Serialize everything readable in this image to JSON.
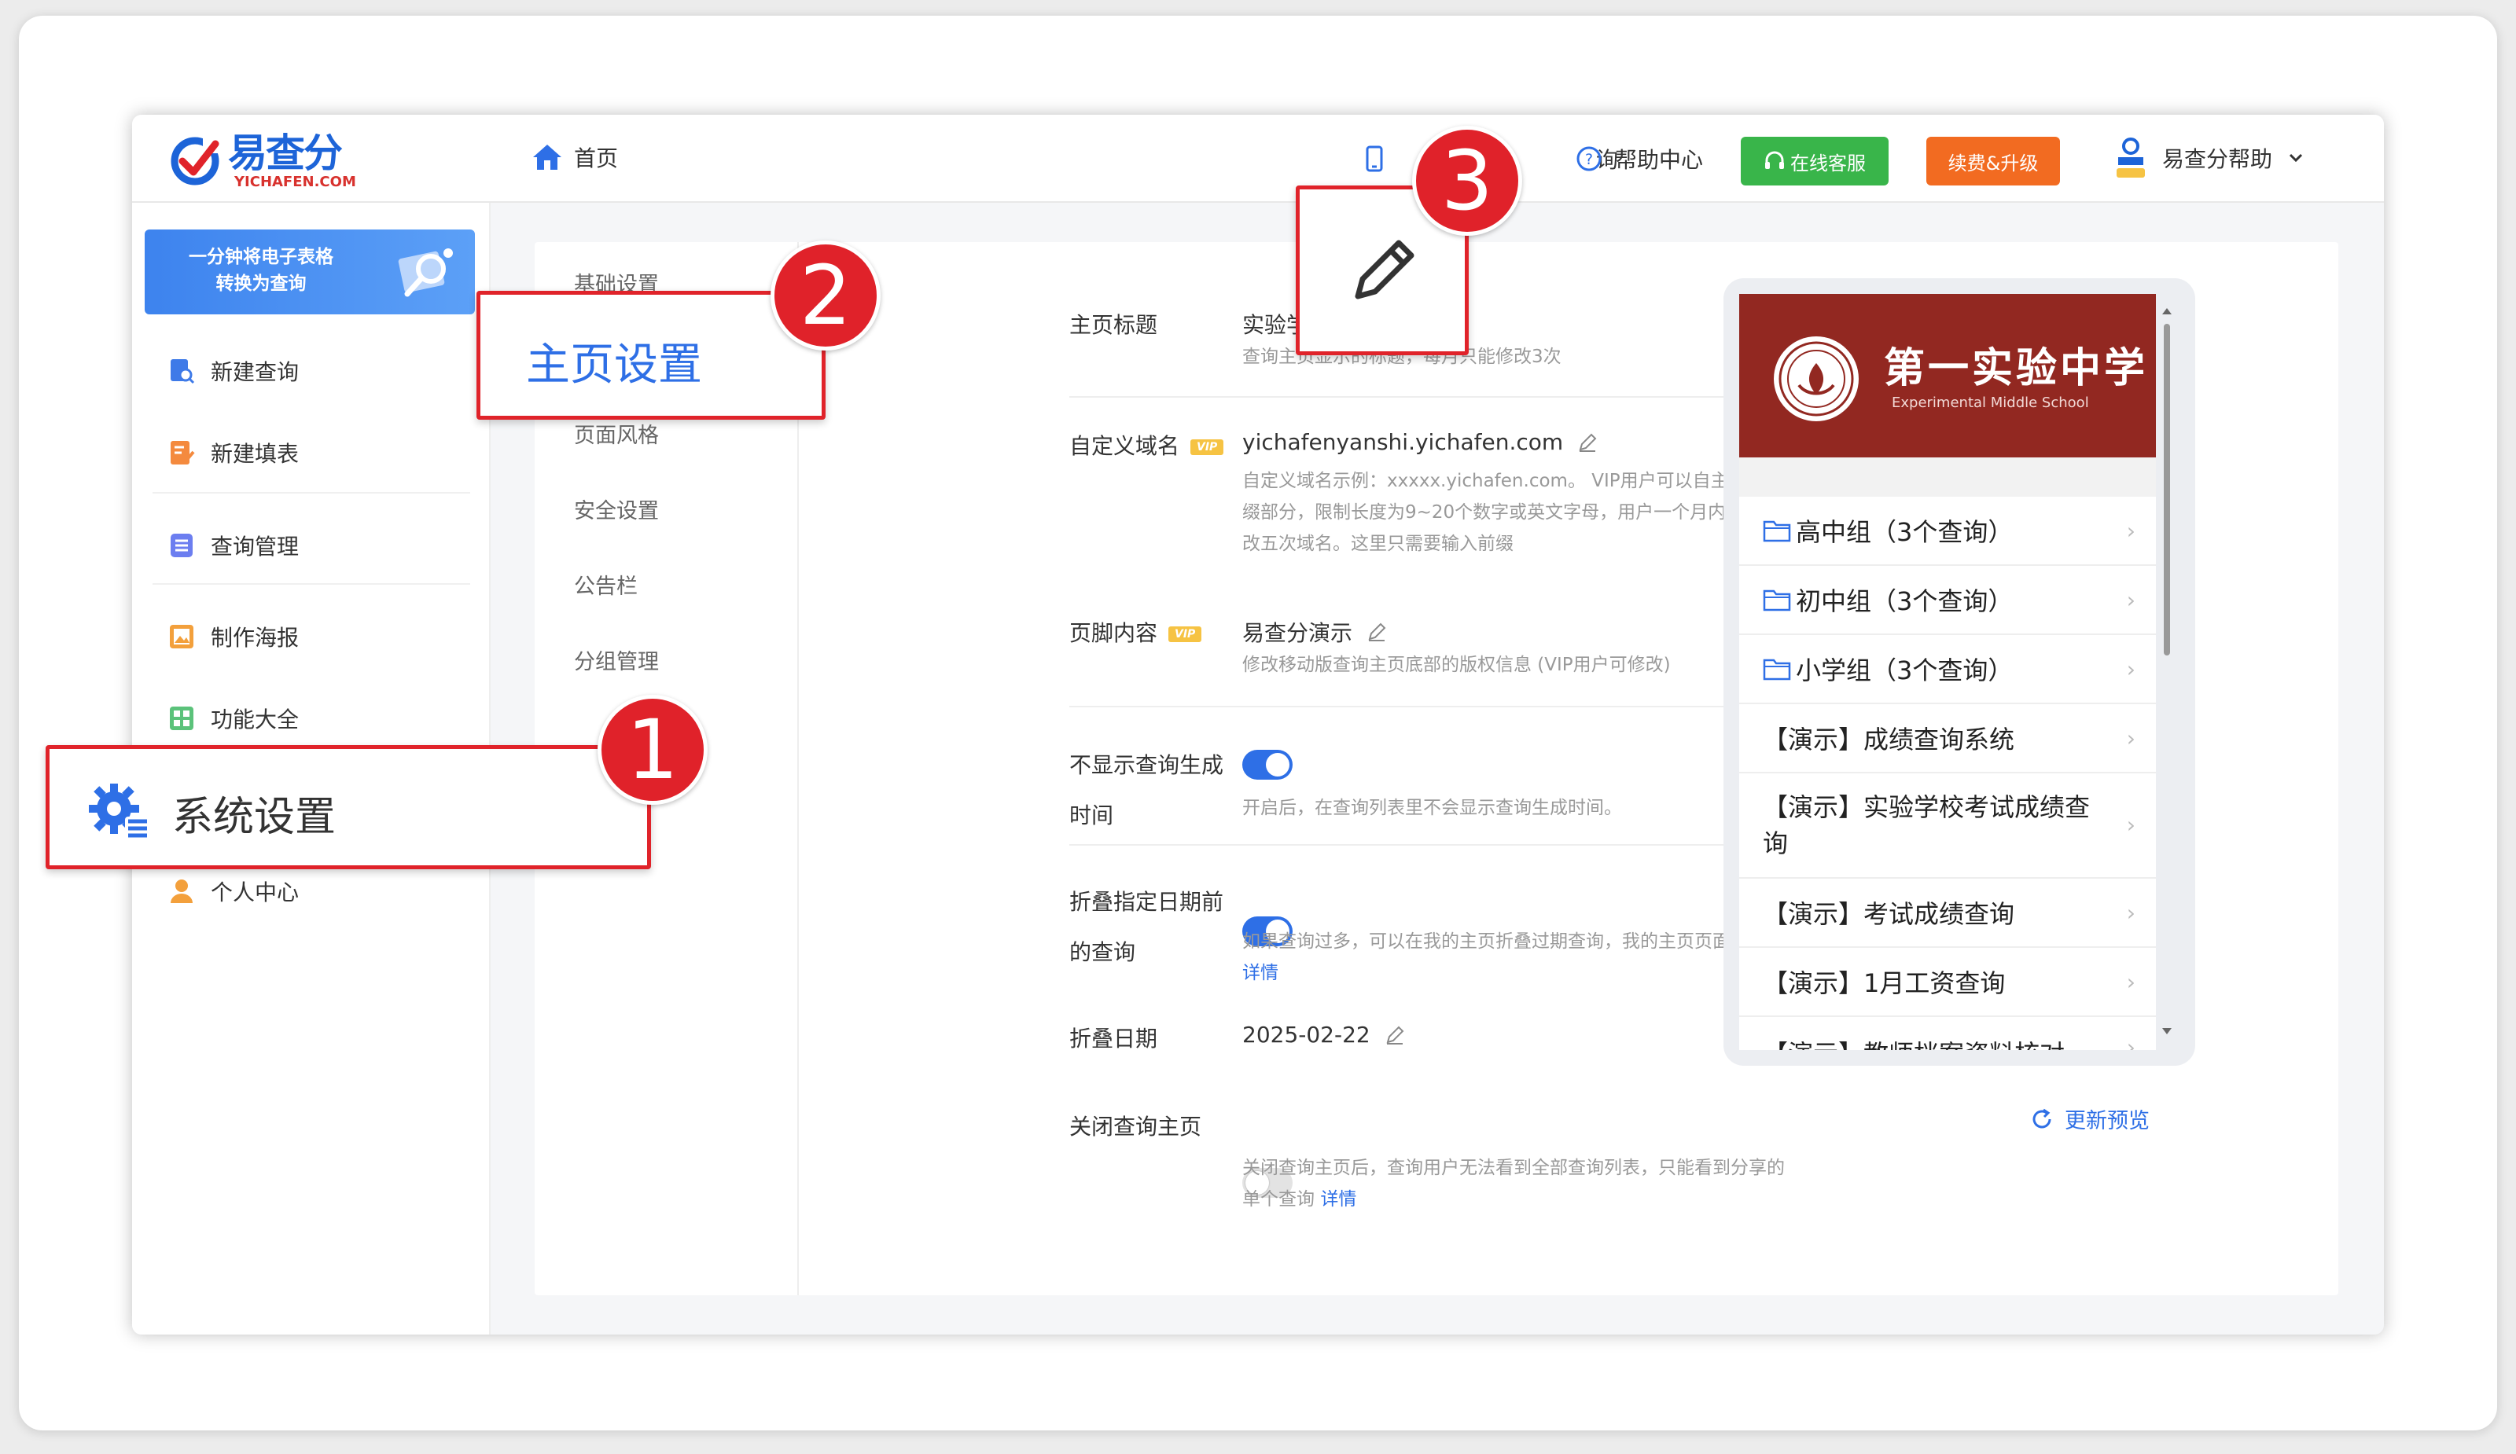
{
  "logo": {
    "cn": "易查分",
    "en": "YICHAFEN.COM"
  },
  "topbar": {
    "home": "首页",
    "mobile_query_partial": "询",
    "help_center": "帮助中心",
    "online_service": "在线客服",
    "renew_upgrade": "续费&升级",
    "user_name": "易查分帮助"
  },
  "sidebar": {
    "banner_line1": "一分钟将电子表格",
    "banner_line2": "转换为查询",
    "items": [
      {
        "label": "新建查询"
      },
      {
        "label": "新建填表"
      },
      {
        "label": "查询管理"
      },
      {
        "label": "制作海报"
      },
      {
        "label": "功能大全"
      },
      {
        "label": "系统设置"
      },
      {
        "label": "个人中心"
      }
    ]
  },
  "subnav": {
    "items": [
      "基础设置",
      "主页设置",
      "页面风格",
      "安全设置",
      "公告栏",
      "分组管理"
    ]
  },
  "form": {
    "title_label": "主页标题",
    "title_value": "实验学校查询系统",
    "title_hint": "查询主页显示的标题，每月只能修改3次",
    "domain_label": "自定义域名",
    "vip": "VIP",
    "domain_value": "yichafenyanshi.yichafen.com",
    "domain_hint": "自定义域名示例：xxxxx.yichafen.com。 VIP用户可以自主修改前缀部分，限制长度为9~20个数字或英文字母，用户一个月内只能修改五次域名。这里只需要输入前缀",
    "footer_label": "页脚内容",
    "footer_value": "易查分演示",
    "footer_hint": "修改移动版查询主页底部的版权信息 (VIP用户可修改)",
    "hide_time_label_1": "不显示查询生成",
    "hide_time_label_2": "时间",
    "hide_time_hint": "开启后，在查询列表里不会显示查询生成时间。",
    "fold_label_1": "折叠指定日期前",
    "fold_label_2": "的查询",
    "fold_hint": "如果查询过多，可以在我的主页折叠过期查询，我的主页页面更简洁",
    "detail_link": "详情",
    "fold_date_label": "折叠日期",
    "fold_date_value": "2025-02-22",
    "close_label": "关闭查询主页",
    "close_hint": "关闭查询主页后，查询用户无法看到全部查询列表，只能看到分享的单个查询"
  },
  "preview": {
    "school_name": "第一实验中学",
    "school_en": "Experimental Middle School",
    "items": [
      "高中组（3个查询）",
      "初中组（3个查询）",
      "小学组（3个查询）",
      "【演示】成绩查询系统",
      "【演示】实验学校考试成绩查询",
      "【演示】考试成绩查询",
      "【演示】1月工资查询",
      "【演示】教师档案资料核对"
    ],
    "refresh": "更新预览"
  },
  "callouts": {
    "one_label": "系统设置",
    "two_label": "主页设置",
    "num1": "1",
    "num2": "2",
    "num3": "3"
  },
  "colors": {
    "primary": "#2e6fe6",
    "green": "#39b54a",
    "orange": "#f26b21",
    "red": "#e0222a",
    "school": "#922821"
  }
}
